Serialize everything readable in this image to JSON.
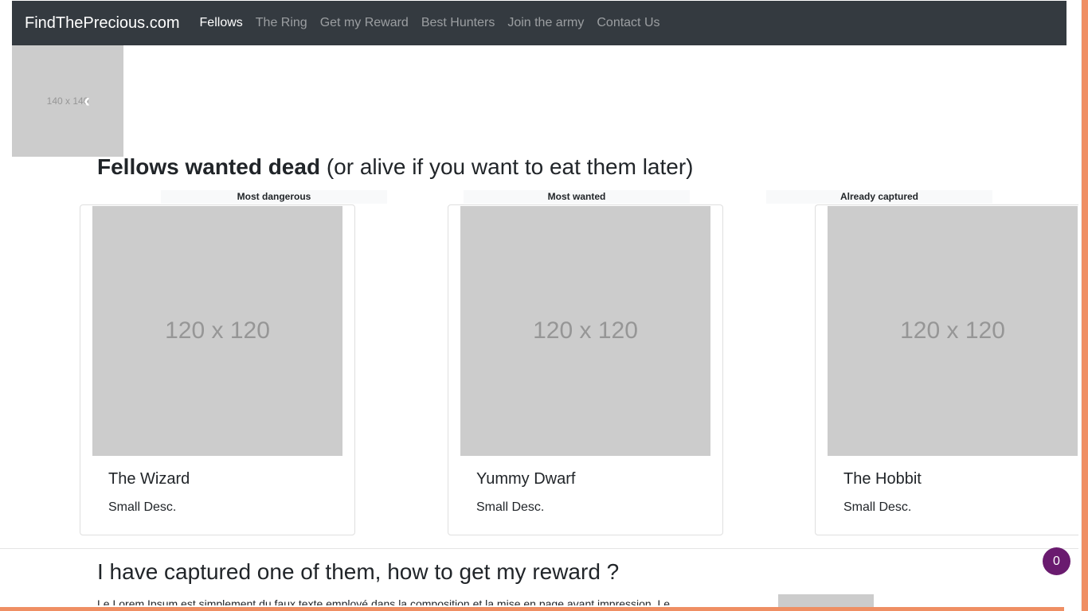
{
  "navbar": {
    "brand": "FindThePrecious.com",
    "links": [
      {
        "label": "Fellows",
        "active": true
      },
      {
        "label": "The Ring",
        "active": false
      },
      {
        "label": "Get my Reward",
        "active": false
      },
      {
        "label": "Best Hunters",
        "active": false
      },
      {
        "label": "Join the army",
        "active": false
      },
      {
        "label": "Contact Us",
        "active": false
      }
    ]
  },
  "carousel": {
    "placeholder": "140 x 140",
    "prev_icon": "chevron-left-icon"
  },
  "section1": {
    "title_strong": "Fellows wanted dead",
    "title_rest": " (or alive if you want to eat them later)",
    "cards": [
      {
        "badge": "Most dangerous",
        "image_text": "120 x 120",
        "title": "The Wizard",
        "desc": "Small Desc."
      },
      {
        "badge": "Most wanted",
        "image_text": "120 x 120",
        "title": "Yummy Dwarf",
        "desc": "Small Desc."
      },
      {
        "badge": "Already captured",
        "image_text": "120 x 120",
        "title": "The Hobbit",
        "desc": "Small Desc."
      }
    ]
  },
  "section2": {
    "title": "I have captured one of them, how to get my reward ?",
    "paragraph": "Le Lorem Ipsum est simplement du faux texte employé dans la composition et la mise en page avant impression. Le"
  },
  "cart": {
    "count": "0"
  },
  "colors": {
    "navbar": "#343a40",
    "accent": "#ef8f64",
    "badge": "#6a1b6f"
  }
}
